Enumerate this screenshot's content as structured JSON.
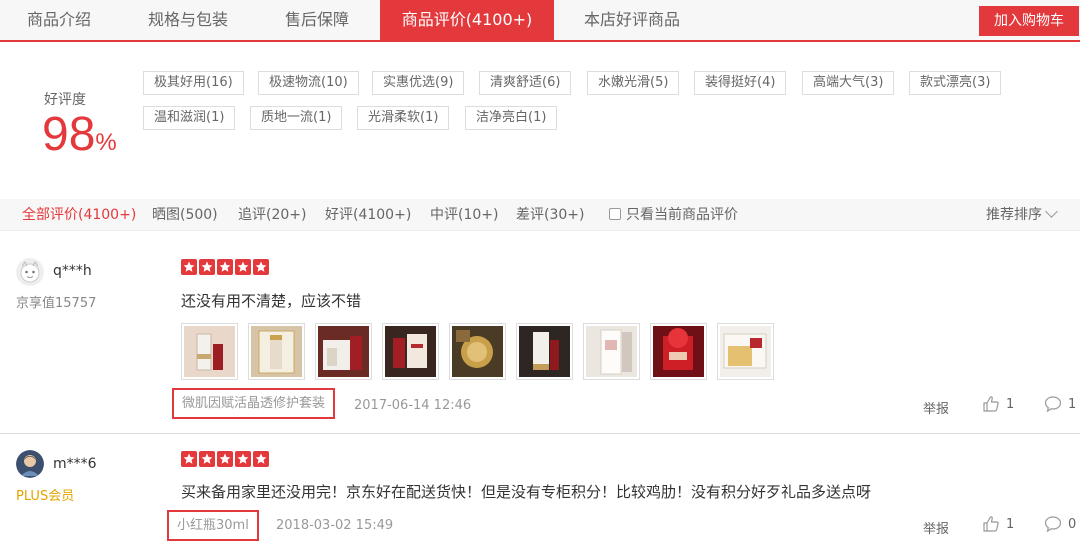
{
  "tabs": [
    {
      "label": "商品介绍",
      "active": false
    },
    {
      "label": "规格与包装",
      "active": false
    },
    {
      "label": "售后保障",
      "active": false
    },
    {
      "label": "商品评价(4100+)",
      "active": true
    },
    {
      "label": "本店好评商品",
      "active": false
    }
  ],
  "cart_button": "加入购物车",
  "rating": {
    "label": "好评度",
    "value": "98",
    "unit": "%"
  },
  "tags": [
    "极其好用(16)",
    "极速物流(10)",
    "实惠优选(9)",
    "清爽舒适(6)",
    "水嫩光滑(5)",
    "装得挺好(4)",
    "高端大气(3)",
    "款式漂亮(3)",
    "温和滋润(1)",
    "质地一流(1)",
    "光滑柔软(1)",
    "洁净亮白(1)"
  ],
  "filters": [
    {
      "label": "全部评价(4100+)",
      "active": true
    },
    {
      "label": "晒图(500)",
      "active": false
    },
    {
      "label": "追评(20+)",
      "active": false
    },
    {
      "label": "好评(4100+)",
      "active": false
    },
    {
      "label": "中评(10+)",
      "active": false
    },
    {
      "label": "差评(30+)",
      "active": false
    }
  ],
  "only_current_label": "只看当前商品评价",
  "sort_label": "推荐排序",
  "reviews": [
    {
      "user": "q***h",
      "level": "京享值15757",
      "stars": 5,
      "content": "还没有用不清楚，应该不错",
      "product": "微肌因赋活晶透修护套装",
      "date": "2017-06-14 12:46",
      "report": "举报",
      "likes": "1",
      "comments": "1"
    },
    {
      "user": "m***6",
      "level": "PLUS会员",
      "stars": 5,
      "content": "买来备用家里还没用完！京东好在配送货快！但是没有专柜积分！比较鸡肋！没有积分好歹礼品多送点呀",
      "product": "小红瓶30ml",
      "date": "2018-03-02 15:49",
      "report": "举报",
      "likes": "1",
      "comments": "0"
    }
  ],
  "colors": {
    "accent": "#e4393c",
    "plus": "#e5a300"
  }
}
